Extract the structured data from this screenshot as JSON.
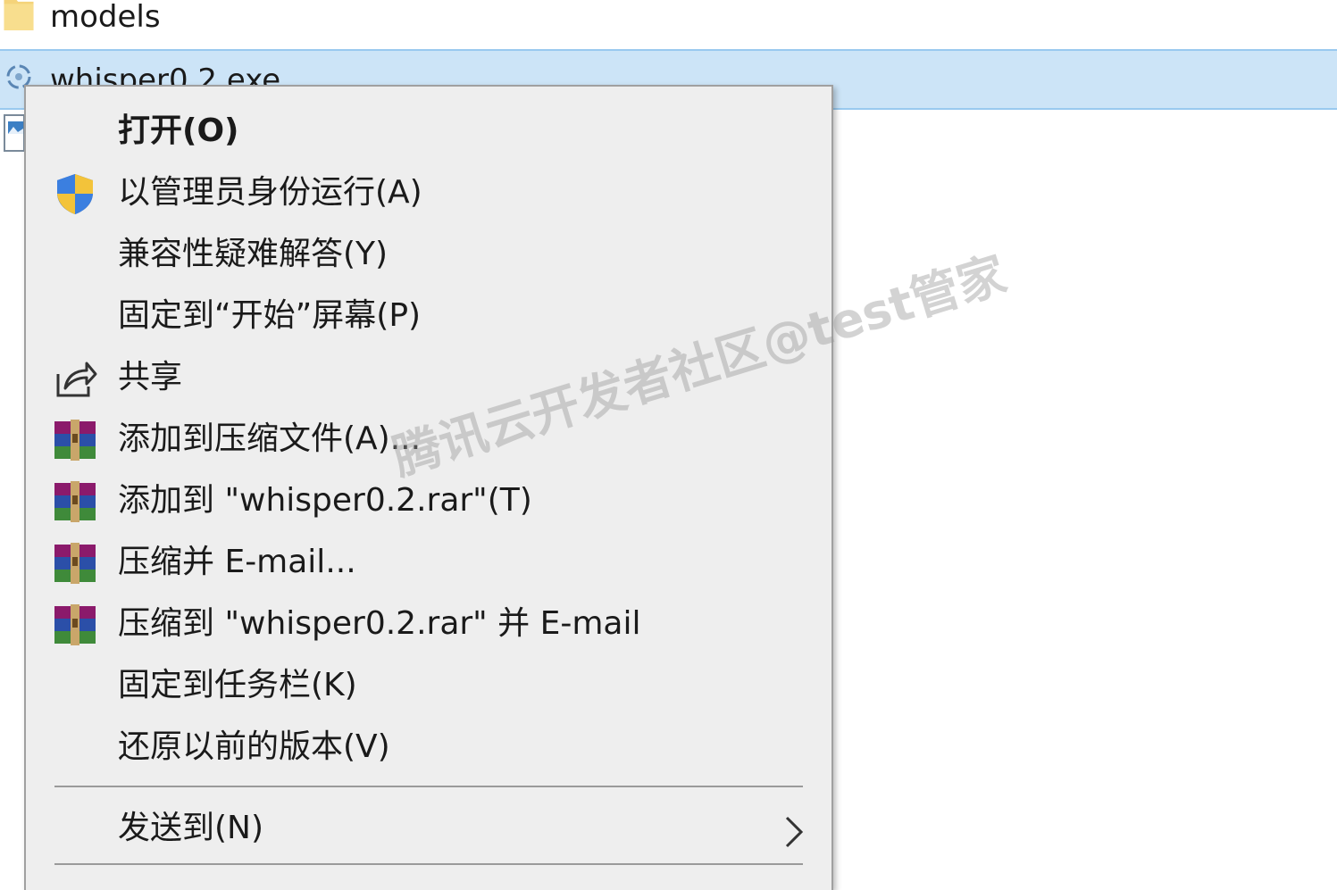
{
  "file_list": {
    "rows": [
      {
        "name": "models",
        "icon": "folder-icon"
      },
      {
        "name": "whisper0.2.exe",
        "icon": "exe-icon",
        "selected": true
      }
    ]
  },
  "context_menu": {
    "items": [
      {
        "label": "打开(O)",
        "icon": "",
        "bold": true
      },
      {
        "label": "以管理员身份运行(A)",
        "icon": "uac-shield-icon"
      },
      {
        "label": "兼容性疑难解答(Y)",
        "icon": ""
      },
      {
        "label": "固定到“开始”屏幕(P)",
        "icon": ""
      },
      {
        "label": "共享",
        "icon": "share-icon"
      },
      {
        "label": "添加到压缩文件(A)...",
        "icon": "winrar-icon"
      },
      {
        "label": "添加到 \"whisper0.2.rar\"(T)",
        "icon": "winrar-icon"
      },
      {
        "label": "压缩并 E-mail...",
        "icon": "winrar-icon"
      },
      {
        "label": "压缩到 \"whisper0.2.rar\" 并 E-mail",
        "icon": "winrar-icon"
      },
      {
        "label": "固定到任务栏(K)",
        "icon": ""
      },
      {
        "label": "还原以前的版本(V)",
        "icon": ""
      },
      {
        "label": "发送到(N)",
        "icon": "",
        "submenu": true
      }
    ]
  },
  "watermark": "腾讯云开发者社区@test管家",
  "colors": {
    "selection": "#cce4f7",
    "selection_border": "#99c9ef",
    "menu_background": "#eeeeee",
    "menu_border": "#a0a0a0"
  }
}
